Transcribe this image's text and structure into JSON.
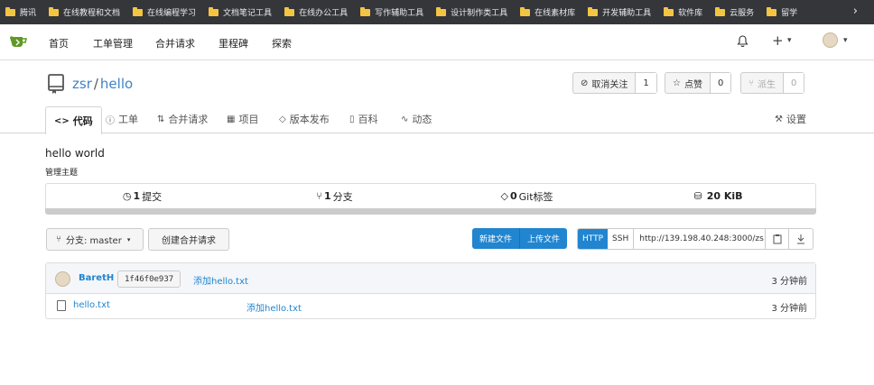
{
  "bookmarks": [
    {
      "label": "腾讯"
    },
    {
      "label": "在线教程和文档"
    },
    {
      "label": "在线编程学习"
    },
    {
      "label": "文档笔记工具"
    },
    {
      "label": "在线办公工具"
    },
    {
      "label": "写作辅助工具"
    },
    {
      "label": "设计制作类工具"
    },
    {
      "label": "在线素材库"
    },
    {
      "label": "开发辅助工具"
    },
    {
      "label": "软件库"
    },
    {
      "label": "云服务"
    },
    {
      "label": "留学"
    }
  ],
  "nav": {
    "home": "首页",
    "issues": "工单管理",
    "pulls": "合并请求",
    "milestones": "里程碑",
    "explore": "探索",
    "plus": "+",
    "caret": "▾"
  },
  "repo": {
    "owner": "zsr",
    "separator": "/",
    "name": "hello",
    "unwatch_label": "取消关注",
    "watch_count": "1",
    "star_label": "点赞",
    "star_count": "0",
    "fork_label": "派生",
    "fork_count": "0"
  },
  "tabs": {
    "code": "代码",
    "issues": "工单",
    "pulls": "合并请求",
    "projects": "项目",
    "releases": "版本发布",
    "wiki": "百科",
    "activity": "动态",
    "settings": "设置"
  },
  "description": "hello world",
  "topics_label": "管理主题",
  "stats": {
    "commits_num": "1",
    "commits_label": "提交",
    "branches_num": "1",
    "branches_label": "分支",
    "tags_num": "0",
    "tags_label": "Git标签",
    "size": "20 KiB"
  },
  "branch": {
    "label": "分支: master",
    "create_pr": "创建合并请求",
    "new_file": "新建文件",
    "upload_file": "上传文件"
  },
  "clone": {
    "http": "HTTP",
    "ssh": "SSH",
    "url": "http://139.198.40.248:3000/zs"
  },
  "latest_commit": {
    "author": "BaretH",
    "sha": "1f46f0e937",
    "message": "添加hello.txt",
    "time": "3 分钟前"
  },
  "files": [
    {
      "name": "hello.txt",
      "message": "添加hello.txt",
      "time": "3 分钟前"
    }
  ],
  "colors": {
    "accent": "#2185d0",
    "link": "#4183c4",
    "bookmark_bar": "#35363a"
  }
}
